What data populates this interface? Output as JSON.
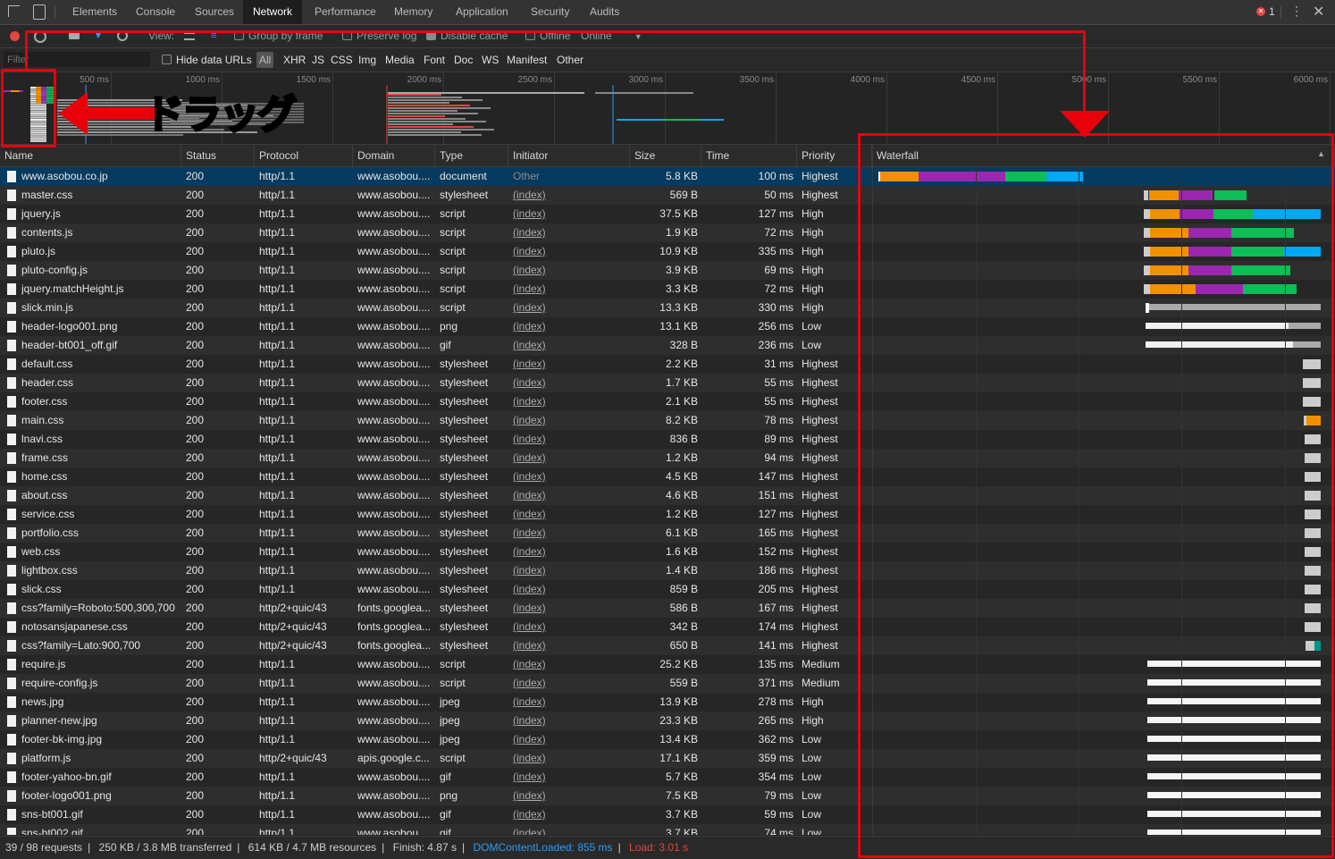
{
  "tabs": [
    "Elements",
    "Console",
    "Sources",
    "Network",
    "Performance",
    "Memory",
    "Application",
    "Security",
    "Audits"
  ],
  "active_tab": "Network",
  "error_count": "1",
  "toolbar": {
    "view_label": "View:",
    "group_by_frame": "Group by frame",
    "preserve_log": "Preserve log",
    "disable_cache": "Disable cache",
    "offline": "Offline",
    "throttle": "Online"
  },
  "filter": {
    "placeholder": "Filter",
    "hide_data_urls": "Hide data URLs",
    "types": [
      "All",
      "XHR",
      "JS",
      "CSS",
      "Img",
      "Media",
      "Font",
      "Doc",
      "WS",
      "Manifest",
      "Other"
    ]
  },
  "overview_ticks": [
    "500 ms",
    "1000 ms",
    "1500 ms",
    "2000 ms",
    "2500 ms",
    "3000 ms",
    "3500 ms",
    "4000 ms",
    "4500 ms",
    "5000 ms",
    "5500 ms",
    "6000 ms"
  ],
  "columns": [
    "Name",
    "Status",
    "Protocol",
    "Domain",
    "Type",
    "Initiator",
    "Size",
    "Time",
    "Priority",
    "Waterfall"
  ],
  "rows": [
    {
      "name": "www.asobou.co.jp",
      "status": "200",
      "protocol": "http/1.1",
      "domain": "www.asobou....",
      "type": "document",
      "initiator": "Other",
      "size": "5.8 KB",
      "time": "100 ms",
      "priority": "Highest",
      "wf": [
        {
          "s": 983,
          "w": 2,
          "c": "#fff"
        },
        {
          "s": 985,
          "w": 43,
          "c": "#f29100"
        },
        {
          "s": 1028,
          "w": 97,
          "c": "#9b27b0"
        },
        {
          "s": 1125,
          "w": 46,
          "c": "#0dbd55"
        },
        {
          "s": 1171,
          "w": 41,
          "c": "#03a9f4"
        }
      ]
    },
    {
      "name": "master.css",
      "status": "200",
      "protocol": "http/1.1",
      "domain": "www.asobou....",
      "type": "stylesheet",
      "initiator": "(index)",
      "size": "569 B",
      "time": "50 ms",
      "priority": "Highest",
      "wf": [
        {
          "s": 1280,
          "w": 5,
          "c": "#ccc"
        },
        {
          "s": 1286,
          "w": 33,
          "c": "#f29100"
        },
        {
          "s": 1319,
          "w": 38,
          "c": "#9b27b0"
        },
        {
          "s": 1359,
          "w": 36,
          "c": "#0dbd55"
        }
      ]
    },
    {
      "name": "jquery.js",
      "status": "200",
      "protocol": "http/1.1",
      "domain": "www.asobou....",
      "type": "script",
      "initiator": "(index)",
      "size": "37.5 KB",
      "time": "127 ms",
      "priority": "High",
      "wf": [
        {
          "s": 1280,
          "w": 7,
          "c": "#ccc"
        },
        {
          "s": 1287,
          "w": 33,
          "c": "#f29100"
        },
        {
          "s": 1320,
          "w": 38,
          "c": "#9b27b0"
        },
        {
          "s": 1358,
          "w": 44,
          "c": "#0dbd55"
        },
        {
          "s": 1402,
          "w": 76,
          "c": "#03a9f4"
        }
      ]
    },
    {
      "name": "contents.js",
      "status": "200",
      "protocol": "http/1.1",
      "domain": "www.asobou....",
      "type": "script",
      "initiator": "(index)",
      "size": "1.9 KB",
      "time": "72 ms",
      "priority": "High",
      "wf": [
        {
          "s": 1280,
          "w": 7,
          "c": "#ccc"
        },
        {
          "s": 1287,
          "w": 43,
          "c": "#f29100"
        },
        {
          "s": 1330,
          "w": 48,
          "c": "#9b27b0"
        },
        {
          "s": 1378,
          "w": 70,
          "c": "#0dbd55"
        }
      ]
    },
    {
      "name": "pluto.js",
      "status": "200",
      "protocol": "http/1.1",
      "domain": "www.asobou....",
      "type": "script",
      "initiator": "(index)",
      "size": "10.9 KB",
      "time": "335 ms",
      "priority": "High",
      "wf": [
        {
          "s": 1280,
          "w": 7,
          "c": "#ccc"
        },
        {
          "s": 1287,
          "w": 43,
          "c": "#f29100"
        },
        {
          "s": 1330,
          "w": 48,
          "c": "#9b27b0"
        },
        {
          "s": 1378,
          "w": 58,
          "c": "#0dbd55"
        },
        {
          "s": 1436,
          "w": 42,
          "c": "#03a9f4"
        }
      ]
    },
    {
      "name": "pluto-config.js",
      "status": "200",
      "protocol": "http/1.1",
      "domain": "www.asobou....",
      "type": "script",
      "initiator": "(index)",
      "size": "3.9 KB",
      "time": "69 ms",
      "priority": "High",
      "wf": [
        {
          "s": 1280,
          "w": 7,
          "c": "#ccc"
        },
        {
          "s": 1287,
          "w": 43,
          "c": "#f29100"
        },
        {
          "s": 1330,
          "w": 48,
          "c": "#9b27b0"
        },
        {
          "s": 1378,
          "w": 66,
          "c": "#0dbd55"
        }
      ]
    },
    {
      "name": "jquery.matchHeight.js",
      "status": "200",
      "protocol": "http/1.1",
      "domain": "www.asobou....",
      "type": "script",
      "initiator": "(index)",
      "size": "3.3 KB",
      "time": "72 ms",
      "priority": "High",
      "wf": [
        {
          "s": 1280,
          "w": 7,
          "c": "#ccc"
        },
        {
          "s": 1287,
          "w": 51,
          "c": "#f29100"
        },
        {
          "s": 1338,
          "w": 53,
          "c": "#9b27b0"
        },
        {
          "s": 1391,
          "w": 60,
          "c": "#0dbd55"
        }
      ]
    },
    {
      "name": "slick.min.js",
      "status": "200",
      "protocol": "http/1.1",
      "domain": "www.asobou....",
      "type": "script",
      "initiator": "(index)",
      "size": "13.3 KB",
      "time": "330 ms",
      "priority": "High",
      "wf": [
        {
          "s": 1282,
          "w": 4,
          "c": "#fff"
        },
        {
          "s": 1286,
          "w": 192,
          "c": "#aaa"
        }
      ]
    },
    {
      "name": "header-logo001.png",
      "status": "200",
      "protocol": "http/1.1",
      "domain": "www.asobou....",
      "type": "png",
      "initiator": "(index)",
      "size": "13.1 KB",
      "time": "256 ms",
      "priority": "Low",
      "wf": [
        {
          "s": 1282,
          "w": 160,
          "c": "#f0f0f0"
        },
        {
          "s": 1442,
          "w": 36,
          "c": "#aaa"
        }
      ]
    },
    {
      "name": "header-bt001_off.gif",
      "status": "200",
      "protocol": "http/1.1",
      "domain": "www.asobou....",
      "type": "gif",
      "initiator": "(index)",
      "size": "328 B",
      "time": "236 ms",
      "priority": "Low",
      "wf": [
        {
          "s": 1282,
          "w": 165,
          "c": "#f0f0f0"
        },
        {
          "s": 1447,
          "w": 31,
          "c": "#aaa"
        }
      ]
    },
    {
      "name": "default.css",
      "status": "200",
      "protocol": "http/1.1",
      "domain": "www.asobou....",
      "type": "stylesheet",
      "initiator": "(index)",
      "size": "2.2 KB",
      "time": "31 ms",
      "priority": "Highest",
      "wf": [
        {
          "s": 1458,
          "w": 20,
          "c": "#ccc"
        }
      ]
    },
    {
      "name": "header.css",
      "status": "200",
      "protocol": "http/1.1",
      "domain": "www.asobou....",
      "type": "stylesheet",
      "initiator": "(index)",
      "size": "1.7 KB",
      "time": "55 ms",
      "priority": "Highest",
      "wf": [
        {
          "s": 1458,
          "w": 20,
          "c": "#ccc"
        }
      ]
    },
    {
      "name": "footer.css",
      "status": "200",
      "protocol": "http/1.1",
      "domain": "www.asobou....",
      "type": "stylesheet",
      "initiator": "(index)",
      "size": "2.1 KB",
      "time": "55 ms",
      "priority": "Highest",
      "wf": [
        {
          "s": 1458,
          "w": 20,
          "c": "#ccc"
        }
      ]
    },
    {
      "name": "main.css",
      "status": "200",
      "protocol": "http/1.1",
      "domain": "www.asobou....",
      "type": "stylesheet",
      "initiator": "(index)",
      "size": "8.2 KB",
      "time": "78 ms",
      "priority": "Highest",
      "wf": [
        {
          "s": 1459,
          "w": 3,
          "c": "#ccc"
        },
        {
          "s": 1462,
          "w": 16,
          "c": "#f29100"
        }
      ]
    },
    {
      "name": "lnavi.css",
      "status": "200",
      "protocol": "http/1.1",
      "domain": "www.asobou....",
      "type": "stylesheet",
      "initiator": "(index)",
      "size": "836 B",
      "time": "89 ms",
      "priority": "Highest",
      "wf": [
        {
          "s": 1460,
          "w": 18,
          "c": "#ccc"
        }
      ]
    },
    {
      "name": "frame.css",
      "status": "200",
      "protocol": "http/1.1",
      "domain": "www.asobou....",
      "type": "stylesheet",
      "initiator": "(index)",
      "size": "1.2 KB",
      "time": "94 ms",
      "priority": "Highest",
      "wf": [
        {
          "s": 1460,
          "w": 18,
          "c": "#ccc"
        }
      ]
    },
    {
      "name": "home.css",
      "status": "200",
      "protocol": "http/1.1",
      "domain": "www.asobou....",
      "type": "stylesheet",
      "initiator": "(index)",
      "size": "4.5 KB",
      "time": "147 ms",
      "priority": "Highest",
      "wf": [
        {
          "s": 1460,
          "w": 18,
          "c": "#ccc"
        }
      ]
    },
    {
      "name": "about.css",
      "status": "200",
      "protocol": "http/1.1",
      "domain": "www.asobou....",
      "type": "stylesheet",
      "initiator": "(index)",
      "size": "4.6 KB",
      "time": "151 ms",
      "priority": "Highest",
      "wf": [
        {
          "s": 1460,
          "w": 18,
          "c": "#ccc"
        }
      ]
    },
    {
      "name": "service.css",
      "status": "200",
      "protocol": "http/1.1",
      "domain": "www.asobou....",
      "type": "stylesheet",
      "initiator": "(index)",
      "size": "1.2 KB",
      "time": "127 ms",
      "priority": "Highest",
      "wf": [
        {
          "s": 1460,
          "w": 18,
          "c": "#ccc"
        }
      ]
    },
    {
      "name": "portfolio.css",
      "status": "200",
      "protocol": "http/1.1",
      "domain": "www.asobou....",
      "type": "stylesheet",
      "initiator": "(index)",
      "size": "6.1 KB",
      "time": "165 ms",
      "priority": "Highest",
      "wf": [
        {
          "s": 1460,
          "w": 18,
          "c": "#ccc"
        }
      ]
    },
    {
      "name": "web.css",
      "status": "200",
      "protocol": "http/1.1",
      "domain": "www.asobou....",
      "type": "stylesheet",
      "initiator": "(index)",
      "size": "1.6 KB",
      "time": "152 ms",
      "priority": "Highest",
      "wf": [
        {
          "s": 1460,
          "w": 18,
          "c": "#ccc"
        }
      ]
    },
    {
      "name": "lightbox.css",
      "status": "200",
      "protocol": "http/1.1",
      "domain": "www.asobou....",
      "type": "stylesheet",
      "initiator": "(index)",
      "size": "1.4 KB",
      "time": "186 ms",
      "priority": "Highest",
      "wf": [
        {
          "s": 1460,
          "w": 18,
          "c": "#ccc"
        }
      ]
    },
    {
      "name": "slick.css",
      "status": "200",
      "protocol": "http/1.1",
      "domain": "www.asobou....",
      "type": "stylesheet",
      "initiator": "(index)",
      "size": "859 B",
      "time": "205 ms",
      "priority": "Highest",
      "wf": [
        {
          "s": 1460,
          "w": 18,
          "c": "#ccc"
        }
      ]
    },
    {
      "name": "css?family=Roboto:500,300,700",
      "status": "200",
      "protocol": "http/2+quic/43",
      "domain": "fonts.googlea...",
      "type": "stylesheet",
      "initiator": "(index)",
      "size": "586 B",
      "time": "167 ms",
      "priority": "Highest",
      "wf": [
        {
          "s": 1460,
          "w": 18,
          "c": "#ccc"
        }
      ]
    },
    {
      "name": "notosansjapanese.css",
      "status": "200",
      "protocol": "http/2+quic/43",
      "domain": "fonts.googlea...",
      "type": "stylesheet",
      "initiator": "(index)",
      "size": "342 B",
      "time": "174 ms",
      "priority": "Highest",
      "wf": [
        {
          "s": 1460,
          "w": 18,
          "c": "#ccc"
        }
      ]
    },
    {
      "name": "css?family=Lato:900,700",
      "status": "200",
      "protocol": "http/2+quic/43",
      "domain": "fonts.googlea...",
      "type": "stylesheet",
      "initiator": "(index)",
      "size": "650 B",
      "time": "141 ms",
      "priority": "Highest",
      "wf": [
        {
          "s": 1461,
          "w": 10,
          "c": "#ccc"
        },
        {
          "s": 1471,
          "w": 7,
          "c": "#009688"
        }
      ]
    },
    {
      "name": "require.js",
      "status": "200",
      "protocol": "http/1.1",
      "domain": "www.asobou....",
      "type": "script",
      "initiator": "(index)",
      "size": "25.2 KB",
      "time": "135 ms",
      "priority": "Medium",
      "wf": [
        {
          "s": 1284,
          "w": 194,
          "c": "#f5f5f5"
        }
      ]
    },
    {
      "name": "require-config.js",
      "status": "200",
      "protocol": "http/1.1",
      "domain": "www.asobou....",
      "type": "script",
      "initiator": "(index)",
      "size": "559 B",
      "time": "371 ms",
      "priority": "Medium",
      "wf": [
        {
          "s": 1284,
          "w": 194,
          "c": "#f5f5f5"
        }
      ]
    },
    {
      "name": "news.jpg",
      "status": "200",
      "protocol": "http/1.1",
      "domain": "www.asobou....",
      "type": "jpeg",
      "initiator": "(index)",
      "size": "13.9 KB",
      "time": "278 ms",
      "priority": "High",
      "wf": [
        {
          "s": 1284,
          "w": 194,
          "c": "#f5f5f5"
        }
      ]
    },
    {
      "name": "planner-new.jpg",
      "status": "200",
      "protocol": "http/1.1",
      "domain": "www.asobou....",
      "type": "jpeg",
      "initiator": "(index)",
      "size": "23.3 KB",
      "time": "265 ms",
      "priority": "High",
      "wf": [
        {
          "s": 1284,
          "w": 194,
          "c": "#f5f5f5"
        }
      ]
    },
    {
      "name": "footer-bk-img.jpg",
      "status": "200",
      "protocol": "http/1.1",
      "domain": "www.asobou....",
      "type": "jpeg",
      "initiator": "(index)",
      "size": "13.4 KB",
      "time": "362 ms",
      "priority": "Low",
      "wf": [
        {
          "s": 1284,
          "w": 194,
          "c": "#f5f5f5"
        }
      ]
    },
    {
      "name": "platform.js",
      "status": "200",
      "protocol": "http/2+quic/43",
      "domain": "apis.google.c...",
      "type": "script",
      "initiator": "(index)",
      "size": "17.1 KB",
      "time": "359 ms",
      "priority": "Low",
      "wf": [
        {
          "s": 1284,
          "w": 194,
          "c": "#f5f5f5"
        }
      ]
    },
    {
      "name": "footer-yahoo-bn.gif",
      "status": "200",
      "protocol": "http/1.1",
      "domain": "www.asobou....",
      "type": "gif",
      "initiator": "(index)",
      "size": "5.7 KB",
      "time": "354 ms",
      "priority": "Low",
      "wf": [
        {
          "s": 1284,
          "w": 194,
          "c": "#f5f5f5"
        }
      ]
    },
    {
      "name": "footer-logo001.png",
      "status": "200",
      "protocol": "http/1.1",
      "domain": "www.asobou....",
      "type": "png",
      "initiator": "(index)",
      "size": "7.5 KB",
      "time": "79 ms",
      "priority": "Low",
      "wf": [
        {
          "s": 1284,
          "w": 194,
          "c": "#f5f5f5"
        }
      ]
    },
    {
      "name": "sns-bt001.gif",
      "status": "200",
      "protocol": "http/1.1",
      "domain": "www.asobou....",
      "type": "gif",
      "initiator": "(index)",
      "size": "3.7 KB",
      "time": "59 ms",
      "priority": "Low",
      "wf": [
        {
          "s": 1284,
          "w": 194,
          "c": "#f5f5f5"
        }
      ]
    },
    {
      "name": "sns-bt002.gif",
      "status": "200",
      "protocol": "http/1.1",
      "domain": "www.asobou....",
      "type": "gif",
      "initiator": "(index)",
      "size": "3.7 KB",
      "time": "74 ms",
      "priority": "Low",
      "wf": [
        {
          "s": 1284,
          "w": 194,
          "c": "#f5f5f5"
        }
      ]
    }
  ],
  "status": {
    "requests": "39 / 98 requests",
    "transferred": "250 KB / 3.8 MB transferred",
    "resources": "614 KB / 4.7 MB resources",
    "finish": "Finish: 4.87 s",
    "dom_content_loaded": "DOMContentLoaded: 855 ms",
    "load": "Load: 3.01 s"
  },
  "annotation": {
    "drag_label": "ドラッグ",
    "color": "#e8000b"
  },
  "colors": {
    "queueing": "#f29100",
    "ssl": "#9b27b0",
    "waiting": "#0dbd55",
    "download": "#03a9f4",
    "dcl": "#2e9cf1",
    "load": "#e2463d"
  }
}
